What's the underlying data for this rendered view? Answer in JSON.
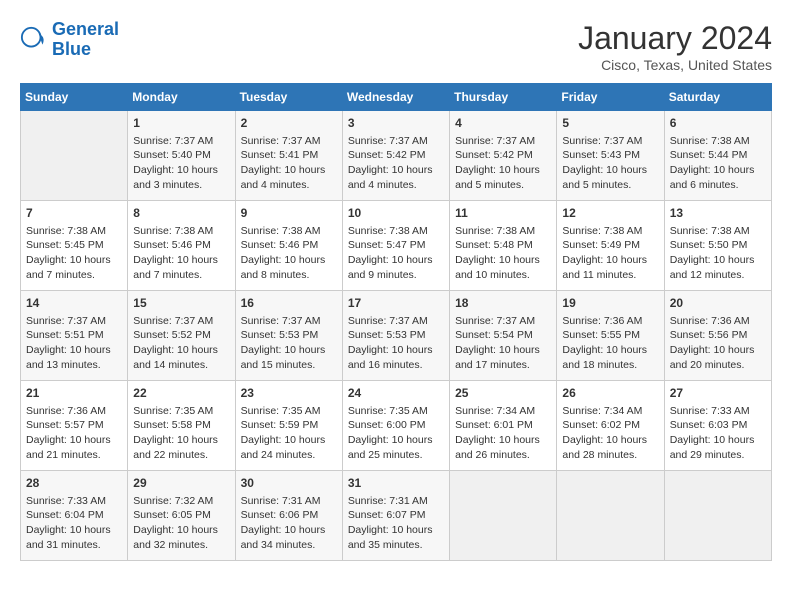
{
  "logo": {
    "line1": "General",
    "line2": "Blue"
  },
  "title": "January 2024",
  "location": "Cisco, Texas, United States",
  "weekdays": [
    "Sunday",
    "Monday",
    "Tuesday",
    "Wednesday",
    "Thursday",
    "Friday",
    "Saturday"
  ],
  "weeks": [
    [
      {
        "day": "",
        "info": ""
      },
      {
        "day": "1",
        "info": "Sunrise: 7:37 AM\nSunset: 5:40 PM\nDaylight: 10 hours\nand 3 minutes."
      },
      {
        "day": "2",
        "info": "Sunrise: 7:37 AM\nSunset: 5:41 PM\nDaylight: 10 hours\nand 4 minutes."
      },
      {
        "day": "3",
        "info": "Sunrise: 7:37 AM\nSunset: 5:42 PM\nDaylight: 10 hours\nand 4 minutes."
      },
      {
        "day": "4",
        "info": "Sunrise: 7:37 AM\nSunset: 5:42 PM\nDaylight: 10 hours\nand 5 minutes."
      },
      {
        "day": "5",
        "info": "Sunrise: 7:37 AM\nSunset: 5:43 PM\nDaylight: 10 hours\nand 5 minutes."
      },
      {
        "day": "6",
        "info": "Sunrise: 7:38 AM\nSunset: 5:44 PM\nDaylight: 10 hours\nand 6 minutes."
      }
    ],
    [
      {
        "day": "7",
        "info": "Sunrise: 7:38 AM\nSunset: 5:45 PM\nDaylight: 10 hours\nand 7 minutes."
      },
      {
        "day": "8",
        "info": "Sunrise: 7:38 AM\nSunset: 5:46 PM\nDaylight: 10 hours\nand 7 minutes."
      },
      {
        "day": "9",
        "info": "Sunrise: 7:38 AM\nSunset: 5:46 PM\nDaylight: 10 hours\nand 8 minutes."
      },
      {
        "day": "10",
        "info": "Sunrise: 7:38 AM\nSunset: 5:47 PM\nDaylight: 10 hours\nand 9 minutes."
      },
      {
        "day": "11",
        "info": "Sunrise: 7:38 AM\nSunset: 5:48 PM\nDaylight: 10 hours\nand 10 minutes."
      },
      {
        "day": "12",
        "info": "Sunrise: 7:38 AM\nSunset: 5:49 PM\nDaylight: 10 hours\nand 11 minutes."
      },
      {
        "day": "13",
        "info": "Sunrise: 7:38 AM\nSunset: 5:50 PM\nDaylight: 10 hours\nand 12 minutes."
      }
    ],
    [
      {
        "day": "14",
        "info": "Sunrise: 7:37 AM\nSunset: 5:51 PM\nDaylight: 10 hours\nand 13 minutes."
      },
      {
        "day": "15",
        "info": "Sunrise: 7:37 AM\nSunset: 5:52 PM\nDaylight: 10 hours\nand 14 minutes."
      },
      {
        "day": "16",
        "info": "Sunrise: 7:37 AM\nSunset: 5:53 PM\nDaylight: 10 hours\nand 15 minutes."
      },
      {
        "day": "17",
        "info": "Sunrise: 7:37 AM\nSunset: 5:53 PM\nDaylight: 10 hours\nand 16 minutes."
      },
      {
        "day": "18",
        "info": "Sunrise: 7:37 AM\nSunset: 5:54 PM\nDaylight: 10 hours\nand 17 minutes."
      },
      {
        "day": "19",
        "info": "Sunrise: 7:36 AM\nSunset: 5:55 PM\nDaylight: 10 hours\nand 18 minutes."
      },
      {
        "day": "20",
        "info": "Sunrise: 7:36 AM\nSunset: 5:56 PM\nDaylight: 10 hours\nand 20 minutes."
      }
    ],
    [
      {
        "day": "21",
        "info": "Sunrise: 7:36 AM\nSunset: 5:57 PM\nDaylight: 10 hours\nand 21 minutes."
      },
      {
        "day": "22",
        "info": "Sunrise: 7:35 AM\nSunset: 5:58 PM\nDaylight: 10 hours\nand 22 minutes."
      },
      {
        "day": "23",
        "info": "Sunrise: 7:35 AM\nSunset: 5:59 PM\nDaylight: 10 hours\nand 24 minutes."
      },
      {
        "day": "24",
        "info": "Sunrise: 7:35 AM\nSunset: 6:00 PM\nDaylight: 10 hours\nand 25 minutes."
      },
      {
        "day": "25",
        "info": "Sunrise: 7:34 AM\nSunset: 6:01 PM\nDaylight: 10 hours\nand 26 minutes."
      },
      {
        "day": "26",
        "info": "Sunrise: 7:34 AM\nSunset: 6:02 PM\nDaylight: 10 hours\nand 28 minutes."
      },
      {
        "day": "27",
        "info": "Sunrise: 7:33 AM\nSunset: 6:03 PM\nDaylight: 10 hours\nand 29 minutes."
      }
    ],
    [
      {
        "day": "28",
        "info": "Sunrise: 7:33 AM\nSunset: 6:04 PM\nDaylight: 10 hours\nand 31 minutes."
      },
      {
        "day": "29",
        "info": "Sunrise: 7:32 AM\nSunset: 6:05 PM\nDaylight: 10 hours\nand 32 minutes."
      },
      {
        "day": "30",
        "info": "Sunrise: 7:31 AM\nSunset: 6:06 PM\nDaylight: 10 hours\nand 34 minutes."
      },
      {
        "day": "31",
        "info": "Sunrise: 7:31 AM\nSunset: 6:07 PM\nDaylight: 10 hours\nand 35 minutes."
      },
      {
        "day": "",
        "info": ""
      },
      {
        "day": "",
        "info": ""
      },
      {
        "day": "",
        "info": ""
      }
    ]
  ]
}
